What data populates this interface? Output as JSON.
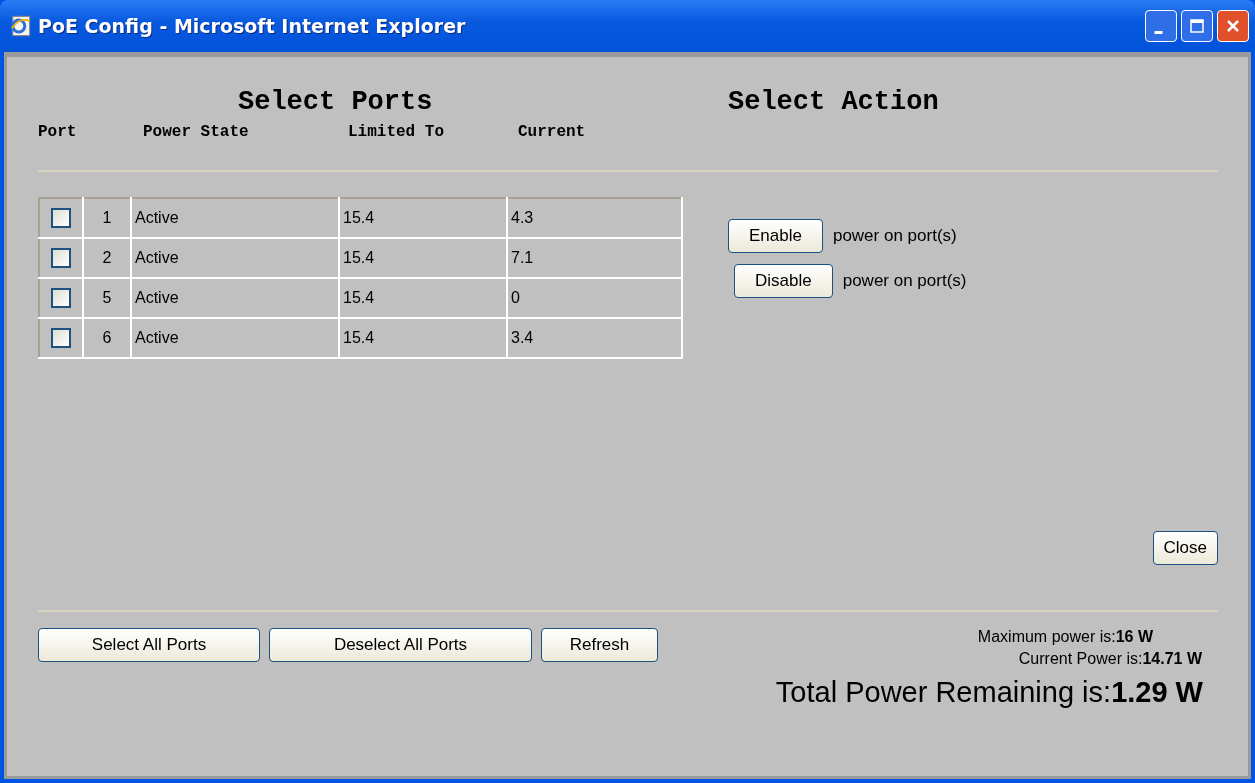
{
  "window": {
    "title": "PoE Config - Microsoft Internet Explorer"
  },
  "ports_heading": "Select Ports",
  "action_heading": "Select Action",
  "columns": [
    "Port",
    "Power State",
    "Limited To",
    "Current"
  ],
  "rows": [
    {
      "checked": false,
      "port": "1",
      "state": "Active",
      "limit": "15.4",
      "current": "4.3"
    },
    {
      "checked": false,
      "port": "2",
      "state": "Active",
      "limit": "15.4",
      "current": "7.1"
    },
    {
      "checked": false,
      "port": "5",
      "state": "Active",
      "limit": "15.4",
      "current": "0"
    },
    {
      "checked": false,
      "port": "6",
      "state": "Active",
      "limit": "15.4",
      "current": "3.4"
    }
  ],
  "actions": [
    {
      "button": "Enable",
      "text": "power on port(s)"
    },
    {
      "button": "Disable",
      "text": "power on port(s)"
    }
  ],
  "close_button": "Close",
  "footer_buttons": [
    "Select All Ports",
    "Deselect All Ports",
    "Refresh"
  ],
  "power": {
    "maximum": "Maximum power is:**16 W**",
    "current": "Current Power is:**14.71 W**",
    "remaining": "Total Power Remaining is:**1.29 W**"
  }
}
